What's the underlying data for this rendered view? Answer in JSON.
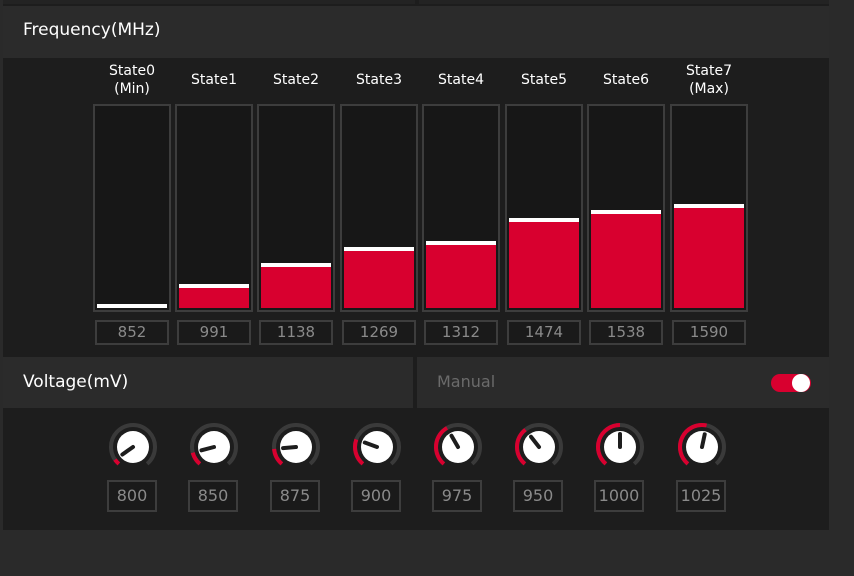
{
  "frequency": {
    "title": "Frequency(MHz)",
    "states": [
      {
        "label": "State0",
        "sub": "(Min)",
        "value": "852",
        "level": 0.0
      },
      {
        "label": "State1",
        "sub": "",
        "value": "991",
        "level": 0.1
      },
      {
        "label": "State2",
        "sub": "",
        "value": "1138",
        "level": 0.2
      },
      {
        "label": "State3",
        "sub": "",
        "value": "1269",
        "level": 0.28
      },
      {
        "label": "State4",
        "sub": "",
        "value": "1312",
        "level": 0.31
      },
      {
        "label": "State5",
        "sub": "",
        "value": "1474",
        "level": 0.42
      },
      {
        "label": "State6",
        "sub": "",
        "value": "1538",
        "level": 0.46
      },
      {
        "label": "State7",
        "sub": "(Max)",
        "value": "1590",
        "level": 0.49
      }
    ]
  },
  "voltage": {
    "title": "Voltage(mV)",
    "mode_label": "Manual",
    "manual_enabled": true,
    "knobs": [
      {
        "value": "800",
        "angle": -125
      },
      {
        "value": "850",
        "angle": -105
      },
      {
        "value": "875",
        "angle": -95
      },
      {
        "value": "900",
        "angle": -70
      },
      {
        "value": "975",
        "angle": -30
      },
      {
        "value": "950",
        "angle": -38
      },
      {
        "value": "1000",
        "angle": 0
      },
      {
        "value": "1025",
        "angle": 12
      }
    ]
  },
  "colors": {
    "accent": "#d8002f",
    "panel": "#1d1d1d",
    "header": "#2b2b2b",
    "border": "#3d3d3d",
    "value_text": "#8a8a8a"
  }
}
